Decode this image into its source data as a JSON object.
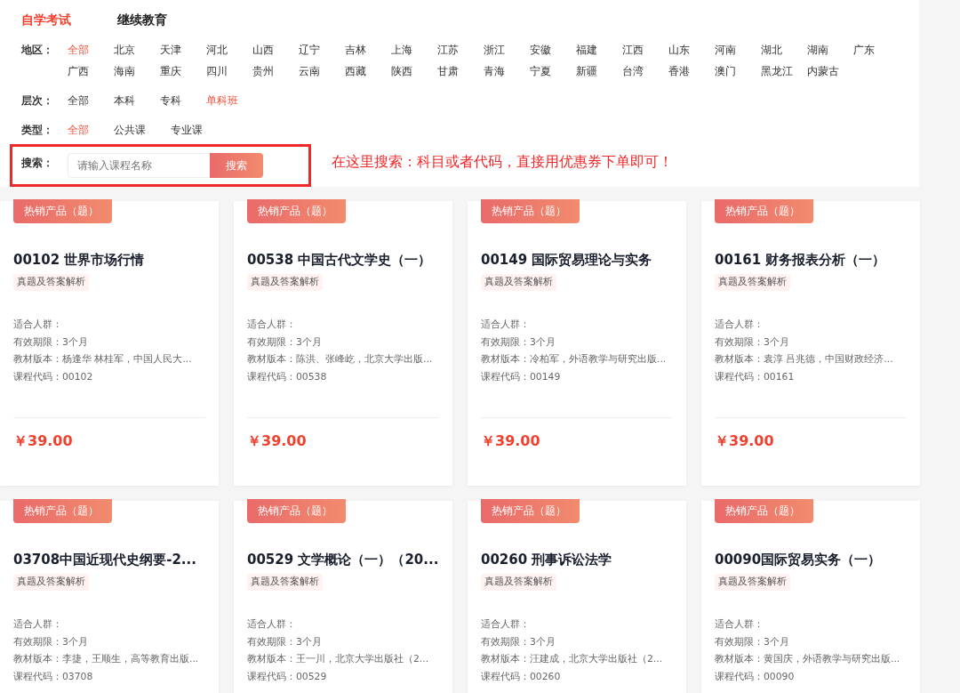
{
  "top_tabs": [
    {
      "label": "自学考试",
      "selected": true
    },
    {
      "label": "继续教育",
      "selected": false
    }
  ],
  "filters": [
    {
      "label": "地区：",
      "options": [
        {
          "label": "全部",
          "selected": true
        },
        {
          "label": "北京",
          "selected": false
        },
        {
          "label": "天津",
          "selected": false
        },
        {
          "label": "河北",
          "selected": false
        },
        {
          "label": "山西",
          "selected": false
        },
        {
          "label": "辽宁",
          "selected": false
        },
        {
          "label": "吉林",
          "selected": false
        },
        {
          "label": "上海",
          "selected": false
        },
        {
          "label": "江苏",
          "selected": false
        },
        {
          "label": "浙江",
          "selected": false
        },
        {
          "label": "安徽",
          "selected": false
        },
        {
          "label": "福建",
          "selected": false
        },
        {
          "label": "江西",
          "selected": false
        },
        {
          "label": "山东",
          "selected": false
        },
        {
          "label": "河南",
          "selected": false
        },
        {
          "label": "湖北",
          "selected": false
        },
        {
          "label": "湖南",
          "selected": false
        },
        {
          "label": "广东",
          "selected": false
        },
        {
          "label": "广西",
          "selected": false
        },
        {
          "label": "海南",
          "selected": false
        },
        {
          "label": "重庆",
          "selected": false
        },
        {
          "label": "四川",
          "selected": false
        },
        {
          "label": "贵州",
          "selected": false
        },
        {
          "label": "云南",
          "selected": false
        },
        {
          "label": "西藏",
          "selected": false
        },
        {
          "label": "陕西",
          "selected": false
        },
        {
          "label": "甘肃",
          "selected": false
        },
        {
          "label": "青海",
          "selected": false
        },
        {
          "label": "宁夏",
          "selected": false
        },
        {
          "label": "新疆",
          "selected": false
        },
        {
          "label": "台湾",
          "selected": false
        },
        {
          "label": "香港",
          "selected": false
        },
        {
          "label": "澳门",
          "selected": false
        },
        {
          "label": "黑龙江",
          "selected": false
        },
        {
          "label": "内蒙古",
          "selected": false
        }
      ]
    },
    {
      "label": "层次：",
      "options": [
        {
          "label": "全部",
          "selected": false
        },
        {
          "label": "本科",
          "selected": false
        },
        {
          "label": "专科",
          "selected": false
        },
        {
          "label": "单科班",
          "selected": true
        }
      ]
    },
    {
      "label": "类型：",
      "options": [
        {
          "label": "全部",
          "selected": true
        },
        {
          "label": "公共课",
          "selected": false
        },
        {
          "label": "专业课",
          "selected": false
        }
      ]
    }
  ],
  "search": {
    "label": "搜索：",
    "placeholder": "请输入课程名称",
    "button": "搜索"
  },
  "annotation": "在这里搜索：科目或者代码，直接用优惠券下单即可！",
  "products": [
    {
      "badge": "热销产品（题）",
      "title": "00102 世界市场行情",
      "tag": "真题及答案解析",
      "info": [
        "适合人群：",
        "有效期限：3个月",
        "教材版本：杨逢华 林桂军，中国人民大...",
        "课程代码：00102"
      ],
      "price": "￥39.00"
    },
    {
      "badge": "热销产品（题）",
      "title": "00538 中国古代文学史（一）",
      "tag": "真题及答案解析",
      "info": [
        "适合人群：",
        "有效期限：3个月",
        "教材版本：陈洪、张峰屹，北京大学出版...",
        "课程代码：00538"
      ],
      "price": "￥39.00"
    },
    {
      "badge": "热销产品（题）",
      "title": "00149 国际贸易理论与实务",
      "tag": "真题及答案解析",
      "info": [
        "适合人群：",
        "有效期限：3个月",
        "教材版本：冷柏军，外语教学与研究出版...",
        "课程代码：00149"
      ],
      "price": "￥39.00"
    },
    {
      "badge": "热销产品（题）",
      "title": "00161 财务报表分析（一）",
      "tag": "真题及答案解析",
      "info": [
        "适合人群：",
        "有效期限：3个月",
        "教材版本：袁淳 吕兆德，中国财政经济...",
        "课程代码：00161"
      ],
      "price": "￥39.00"
    },
    {
      "badge": "热销产品（题）",
      "title": "03708中国近现代史纲要-2...",
      "tag": "真题及答案解析",
      "info": [
        "适合人群：",
        "有效期限：3个月",
        "教材版本：李捷，王顺生，高等教育出版...",
        "课程代码：03708"
      ]
    },
    {
      "badge": "热销产品（题）",
      "title": "00529 文学概论（一）（20...",
      "tag": "真题及答案解析",
      "info": [
        "适合人群：",
        "有效期限：3个月",
        "教材版本：王一川，北京大学出版社（2...",
        "课程代码：00529"
      ]
    },
    {
      "badge": "热销产品（题）",
      "title": "00260 刑事诉讼法学",
      "tag": "真题及答案解析",
      "info": [
        "适合人群：",
        "有效期限：3个月",
        "教材版本：汪建成，北京大学出版社（2...",
        "课程代码：00260"
      ]
    },
    {
      "badge": "热销产品（题）",
      "title": "00090国际贸易实务（一）",
      "tag": "真题及答案解析",
      "info": [
        "适合人群：",
        "有效期限：3个月",
        "教材版本：黄国庆，外语教学与研究出版...",
        "课程代码：00090"
      ]
    }
  ]
}
